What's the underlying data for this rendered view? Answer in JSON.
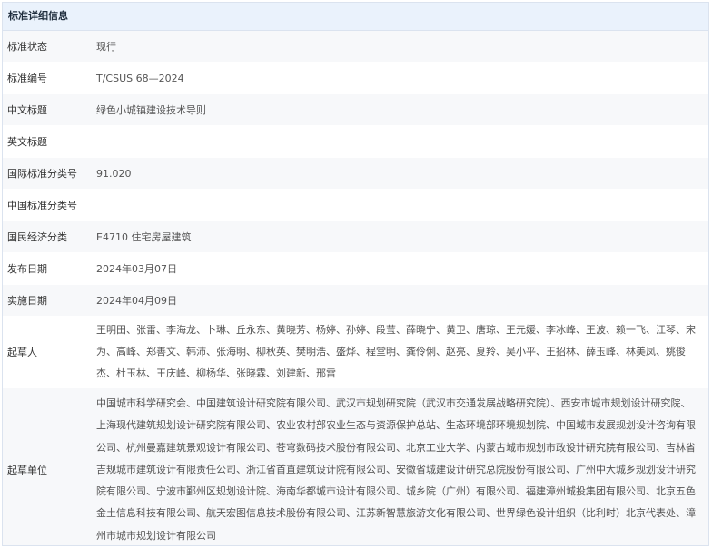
{
  "header": {
    "title": "标准详细信息"
  },
  "rows": [
    {
      "label": "标准状态",
      "value": "现行"
    },
    {
      "label": "标准编号",
      "value": "T/CSUS 68—2024"
    },
    {
      "label": "中文标题",
      "value": "绿色小城镇建设技术导则"
    },
    {
      "label": "英文标题",
      "value": ""
    },
    {
      "label": "国际标准分类号",
      "value": "91.020"
    },
    {
      "label": "中国标准分类号",
      "value": ""
    },
    {
      "label": "国民经济分类",
      "value": "E4710 住宅房屋建筑"
    },
    {
      "label": "发布日期",
      "value": "2024年03月07日"
    },
    {
      "label": "实施日期",
      "value": "2024年04月09日"
    },
    {
      "label": "起草人",
      "value": "王明田、张雷、李海龙、卜琳、丘永东、黄晓芳、杨婷、孙婷、段莹、薛晓宁、黄卫、唐琼、王元媛、李冰峰、王波、赖一飞、江琴、宋为、高峰、郑善文、韩沛、张海明、柳秋英、樊明浩、盛烨、程堂明、龚伶俐、赵亮、夏羚、吴小平、王招林、薛玉峰、林美凤、姚俊杰、杜玉林、王庆峰、柳杨华、张晓霖、刘建新、邢雷"
    },
    {
      "label": "起草单位",
      "value": "中国城市科学研究会、中国建筑设计研究院有限公司、武汉市规划研究院（武汉市交通发展战略研究院）、西安市城市规划设计研究院、上海现代建筑规划设计研究院有限公司、农业农村部农业生态与资源保护总站、生态环境部环境规划院、中国城市发展规划设计咨询有限公司、杭州曼嘉建筑景观设计有限公司、苍穹数码技术股份有限公司、北京工业大学、内蒙古城市规划市政设计研究院有限公司、吉林省吉规城市建筑设计有限责任公司、浙江省首直建筑设计院有限公司、安徽省城建设计研究总院股份有限公司、广州中大城乡规划设计研究院有限公司、宁波市鄞州区规划设计院、海南华都城市设计有限公司、城乡院（广州）有限公司、福建漳州城投集团有限公司、北京五色金土信息科技有限公司、航天宏图信息技术股份有限公司、江苏新智慧旅游文化有限公司、世界绿色设计组织（比利时）北京代表处、漳州市城市规划设计有限公司"
    }
  ]
}
